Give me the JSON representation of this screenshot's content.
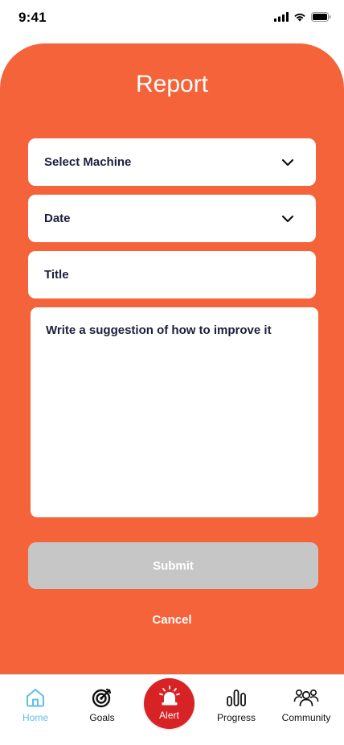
{
  "status_bar": {
    "time": "9:41",
    "icons": [
      "cellular-signal-icon",
      "wifi-icon",
      "battery-icon"
    ]
  },
  "page": {
    "title": "Report"
  },
  "form": {
    "select_machine": {
      "label": "Select Machine",
      "icon": "chevron-down-icon"
    },
    "date": {
      "label": "Date",
      "icon": "chevron-down-icon"
    },
    "title_field": {
      "placeholder": "Title"
    },
    "suggestion": {
      "placeholder": "Write a suggestion of how to improve it"
    },
    "submit_label": "Submit",
    "cancel_label": "Cancel"
  },
  "bottom_nav": {
    "items": [
      {
        "label": "Home",
        "icon": "home-icon",
        "active": true
      },
      {
        "label": "Goals",
        "icon": "target-icon",
        "active": false
      },
      {
        "label": "Alert",
        "icon": "siren-icon",
        "active": false
      },
      {
        "label": "Progress",
        "icon": "bar-chart-icon",
        "active": false
      },
      {
        "label": "Community",
        "icon": "people-icon",
        "active": false
      }
    ]
  },
  "colors": {
    "panel": "#F5633A",
    "submit_disabled": "#C6C6C6",
    "alert": "#D72325",
    "active_nav": "#5BC0E8",
    "text_dark": "#1C1F3B"
  }
}
